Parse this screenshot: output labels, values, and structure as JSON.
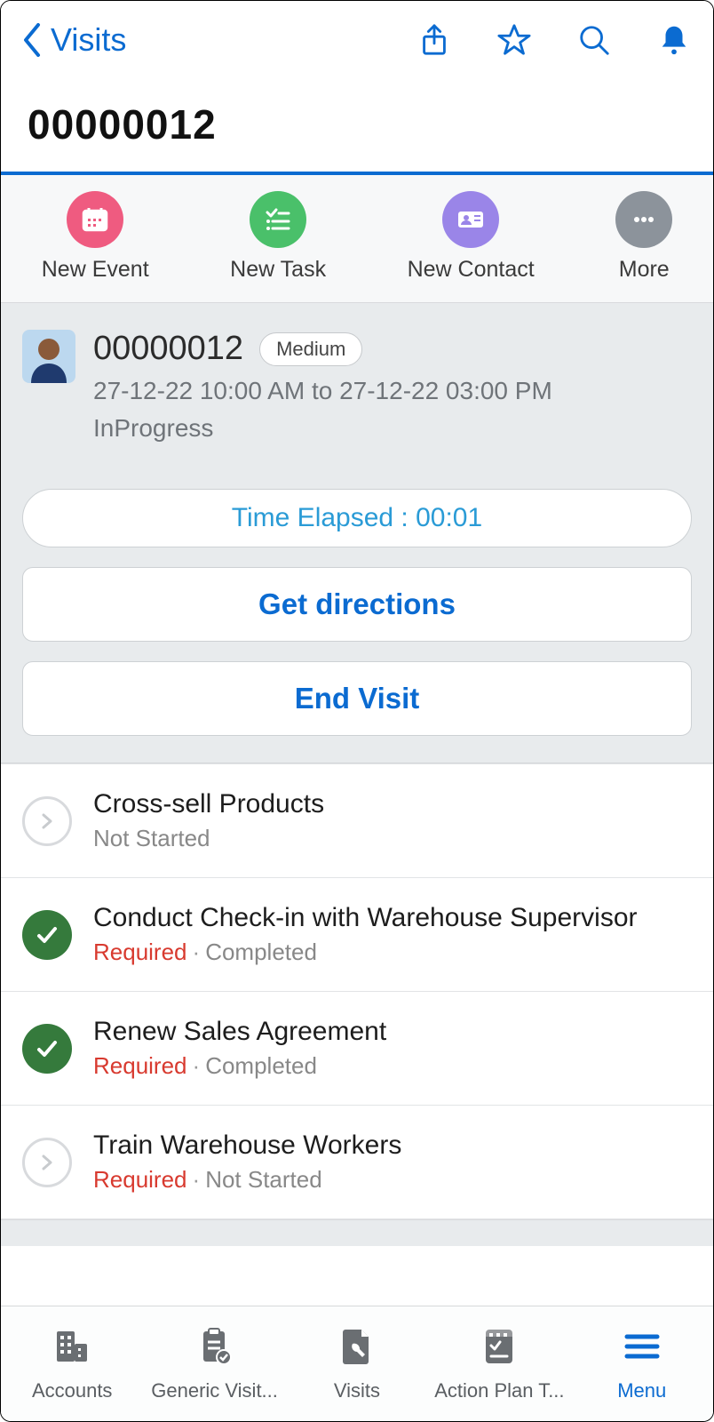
{
  "header": {
    "back_label": "Visits",
    "title": "00000012"
  },
  "actions": [
    {
      "label": "New Event",
      "color": "c-pink",
      "icon": "calendar-icon"
    },
    {
      "label": "New Task",
      "color": "c-green",
      "icon": "checklist-icon"
    },
    {
      "label": "New Contact",
      "color": "c-purple",
      "icon": "id-card-icon"
    },
    {
      "label": "More",
      "color": "c-grey",
      "icon": "dots-icon"
    }
  ],
  "record": {
    "id": "00000012",
    "priority": "Medium",
    "daterange": "27-12-22 10:00 AM to 27-12-22 03:00 PM",
    "status": "InProgress"
  },
  "buttons": {
    "time_elapsed": "Time Elapsed : 00:01",
    "get_directions": "Get directions",
    "end_visit": "End Visit"
  },
  "tasks": [
    {
      "title": "Cross-sell Products",
      "required": false,
      "status": "Not Started",
      "done": false
    },
    {
      "title": "Conduct Check-in with Warehouse Supervisor",
      "required": true,
      "status": "Completed",
      "done": true
    },
    {
      "title": "Renew Sales Agreement",
      "required": true,
      "status": "Completed",
      "done": true
    },
    {
      "title": "Train Warehouse Workers",
      "required": true,
      "status": "Not Started",
      "done": false
    }
  ],
  "labels": {
    "required": "Required"
  },
  "tabs": [
    {
      "label": "Accounts",
      "icon": "building-icon",
      "active": false
    },
    {
      "label": "Generic Visit...",
      "icon": "clipboard-check-icon",
      "active": false
    },
    {
      "label": "Visits",
      "icon": "file-wrench-icon",
      "active": false
    },
    {
      "label": "Action Plan T...",
      "icon": "checklist-doc-icon",
      "active": false
    },
    {
      "label": "Menu",
      "icon": "menu-icon",
      "active": true
    }
  ]
}
